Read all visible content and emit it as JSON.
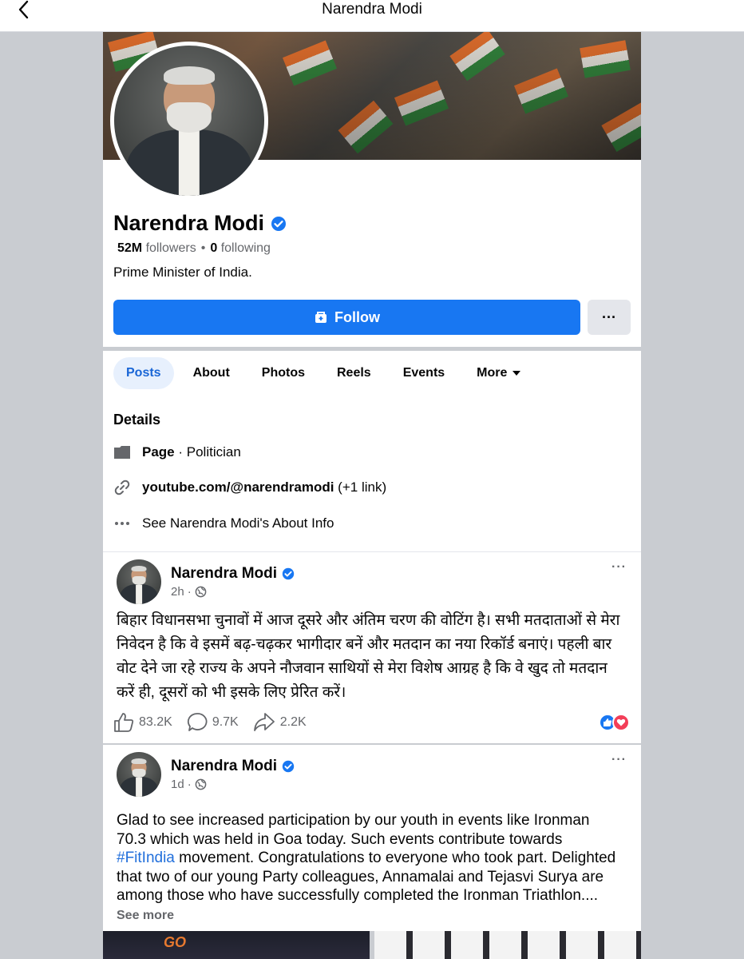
{
  "topbar": {
    "title": "Narendra Modi"
  },
  "profile": {
    "name": "Narendra Modi",
    "followers_count": "52M",
    "followers_label": "followers",
    "following_count": "0",
    "following_label": "following",
    "bio": "Prime Minister of India.",
    "follow_label": "Follow",
    "more_label": "···"
  },
  "tabs": [
    {
      "label": "Posts",
      "active": true
    },
    {
      "label": "About"
    },
    {
      "label": "Photos"
    },
    {
      "label": "Reels"
    },
    {
      "label": "Events"
    },
    {
      "label": "More"
    }
  ],
  "details": {
    "title": "Details",
    "page_label": "Page",
    "page_category": " · Politician",
    "link": "youtube.com/@narendramodi",
    "link_extra": " (+1 link)",
    "about_info": "See Narendra Modi's About Info"
  },
  "posts": [
    {
      "author": "Narendra Modi",
      "time": "2h",
      "text": "बिहार विधानसभा चुनावों में आज दूसरे और अंतिम चरण की वोटिंग है। सभी मतदाताओं से मेरा निवेदन है कि वे इसमें बढ़-चढ़कर भागीदार बनें और मतदान का नया रिकॉर्ड बनाएं। पहली बार वोट देने जा रहे राज्य के अपने नौजवान साथियों से मेरा विशेष आग्रह है कि वे खुद तो मतदान करें ही, दूसरों को भी इसके लिए प्रेरित करें।",
      "likes": "83.2K",
      "comments": "9.7K",
      "shares": "2.2K"
    },
    {
      "author": "Narendra Modi",
      "time": "1d",
      "text_before": "Glad to see increased participation by our youth in events like Ironman 70.3 which was held in Goa today. Such events contribute towards ",
      "hashtag": "#FitIndia",
      "text_after": " movement. Congratulations to everyone who took part. Delighted that two of our young Party colleagues, Annamalai and Tejasvi Surya are among those who have successfully completed the Ironman Triathlon....",
      "see_more": "See more"
    }
  ],
  "colors": {
    "accent": "#1877f2",
    "link": "#216fdb",
    "muted": "#65676b"
  }
}
